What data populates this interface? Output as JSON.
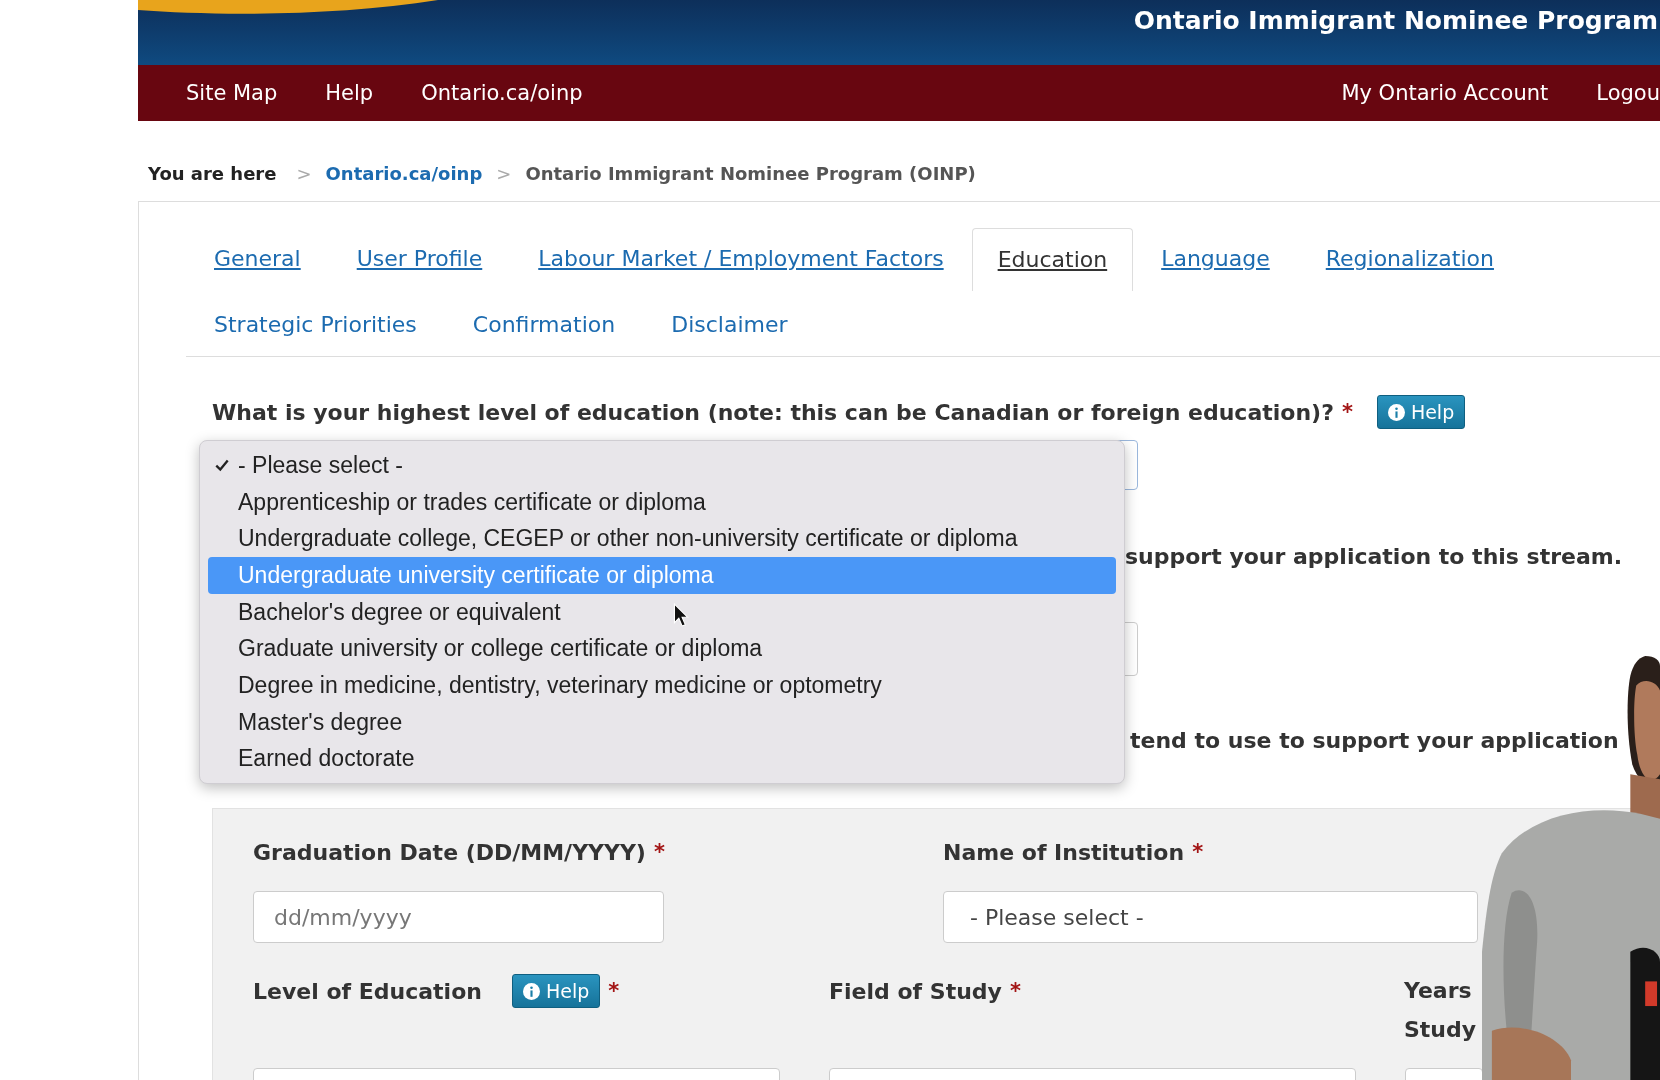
{
  "header": {
    "title": "Ontario Immigrant Nominee Program"
  },
  "top_nav": {
    "left": [
      "Site Map",
      "Help",
      "Ontario.ca/oinp"
    ],
    "right": [
      "My Ontario Account",
      "Logou"
    ]
  },
  "breadcrumb": {
    "label": "You are here",
    "separator": ">",
    "items": [
      {
        "text": "Ontario.ca/oinp",
        "link": true
      },
      {
        "text": "Ontario Immigrant Nominee Program (OINP)",
        "link": false
      }
    ]
  },
  "tabs": [
    [
      {
        "label": "General",
        "selected": false
      },
      {
        "label": "User Profile",
        "selected": false
      },
      {
        "label": "Labour Market / Employment Factors",
        "selected": false
      },
      {
        "label": "Education",
        "selected": true
      },
      {
        "label": "Language",
        "selected": false
      },
      {
        "label": "Regionalization",
        "selected": false
      }
    ],
    [
      {
        "label": "Strategic Priorities",
        "selected": false
      },
      {
        "label": "Confirmation",
        "selected": false
      },
      {
        "label": "Disclaimer",
        "selected": false
      }
    ]
  ],
  "question": {
    "text": "What is your highest level of education (note: this can be Canadian or foreign education)?",
    "required": "*",
    "help": "Help"
  },
  "hidden_texts": [
    "support your application to this stream.",
    "tend to use to support your application"
  ],
  "dropdown": {
    "options": [
      {
        "label": "- Please select -",
        "checked": true,
        "selected": false
      },
      {
        "label": "Apprenticeship or trades certificate or diploma",
        "checked": false,
        "selected": false
      },
      {
        "label": "Undergraduate college, CEGEP or other non-university certificate or diploma",
        "checked": false,
        "selected": false
      },
      {
        "label": "Undergraduate university certificate or diploma",
        "checked": false,
        "selected": true
      },
      {
        "label": "Bachelor's degree or equivalent",
        "checked": false,
        "selected": false
      },
      {
        "label": "Graduate university or college certificate or diploma",
        "checked": false,
        "selected": false
      },
      {
        "label": "Degree in medicine, dentistry, veterinary medicine or optometry",
        "checked": false,
        "selected": false
      },
      {
        "label": "Master's degree",
        "checked": false,
        "selected": false
      },
      {
        "label": "Earned doctorate",
        "checked": false,
        "selected": false
      }
    ]
  },
  "education_form": {
    "graduation_date": {
      "label": "Graduation Date (DD/MM/YYYY)",
      "required": "*",
      "placeholder": "dd/mm/yyyy"
    },
    "institution": {
      "label": "Name of Institution",
      "required": "*",
      "value": "- Please select -"
    },
    "level": {
      "label": "Level of Education",
      "help": "Help",
      "required": "*"
    },
    "field": {
      "label": "Field of Study",
      "required": "*"
    },
    "years": {
      "label_lines": [
        "Years",
        "Study"
      ]
    }
  },
  "video_overlay": {
    "kind": "picture"
  }
}
